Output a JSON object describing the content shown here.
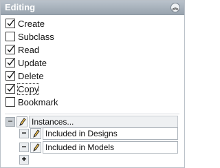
{
  "panel": {
    "title": "Editing",
    "collapse_icon": "double-chevron-up-icon"
  },
  "checkboxes": [
    {
      "label": "Create",
      "checked": true
    },
    {
      "label": "Subclass",
      "checked": false
    },
    {
      "label": "Read",
      "checked": true
    },
    {
      "label": "Update",
      "checked": true
    },
    {
      "label": "Delete",
      "checked": true
    },
    {
      "label": "Copy",
      "checked": true
    },
    {
      "label": "Bookmark",
      "checked": false
    }
  ],
  "instances": {
    "label": "Instances...",
    "toggle": "−",
    "items": [
      {
        "remove": "−",
        "value": "Included in Designs"
      },
      {
        "remove": "−",
        "value": "Included in Models"
      }
    ],
    "add": "+"
  }
}
